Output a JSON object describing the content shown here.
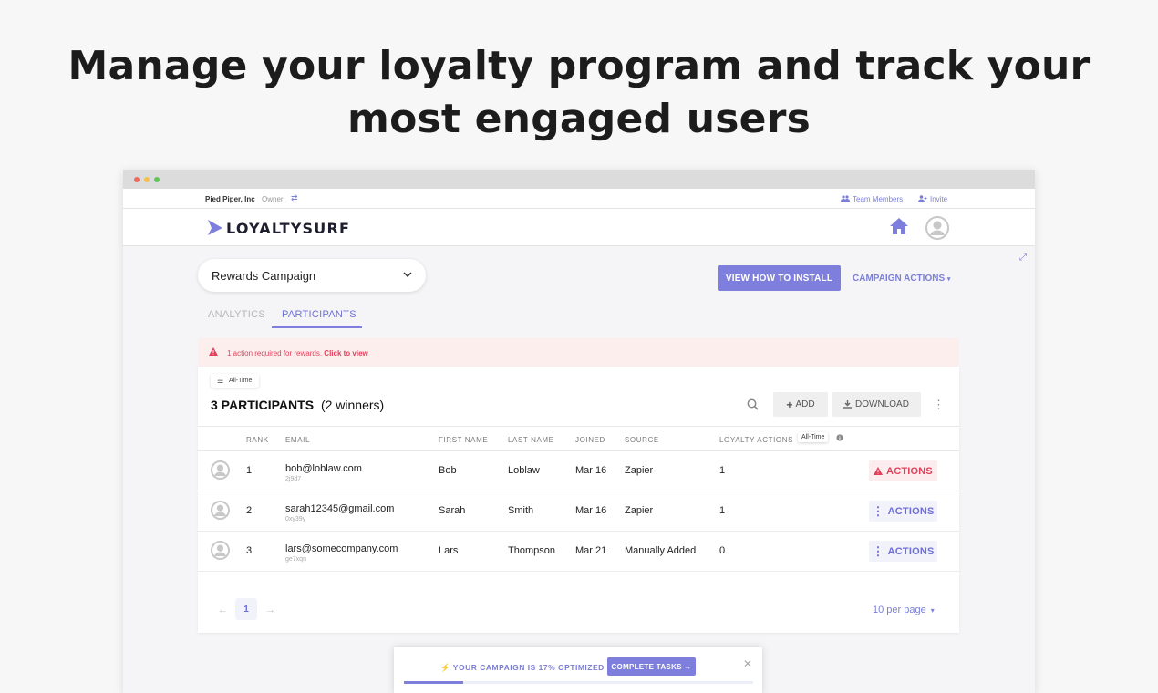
{
  "hero": {
    "line1": "Manage your loyalty program and track your",
    "line2": "most engaged users"
  },
  "colors": {
    "accent": "#7e7fdc",
    "warning": "#e0405a",
    "window_dots": [
      "#ed6a5e",
      "#f5bf4f",
      "#61c554"
    ]
  },
  "orgbar": {
    "org_name": "Pied Piper, Inc",
    "role": "Owner",
    "team_members": "Team Members",
    "invite": "Invite"
  },
  "navbar": {
    "logo_text": "LOYALTYSURF",
    "icons": [
      "home-icon",
      "user-avatar"
    ]
  },
  "campaign": {
    "selected": "Rewards Campaign",
    "install_button": "VIEW HOW TO INSTALL",
    "actions_menu": "CAMPAIGN ACTIONS"
  },
  "tabs": [
    {
      "label": "ANALYTICS",
      "active": false
    },
    {
      "label": "PARTICIPANTS",
      "active": true
    }
  ],
  "alert": {
    "message": "1 action required for rewards.",
    "link": "Click to view"
  },
  "panel": {
    "filter_chip": "All-Time",
    "title_count": "3 PARTICIPANTS",
    "title_winners": "(2 winners)",
    "add_button": "ADD",
    "download_button": "DOWNLOAD"
  },
  "table": {
    "headers": [
      "RANK",
      "EMAIL",
      "FIRST NAME",
      "LAST NAME",
      "JOINED",
      "SOURCE",
      "LOYALTY ACTIONS"
    ],
    "loyalty_tooltip": "All-Time",
    "rows": [
      {
        "rank": "1",
        "email": "bob@loblaw.com",
        "code": "2j9d7",
        "first": "Bob",
        "last": "Loblaw",
        "joined": "Mar 16",
        "source": "Zapier",
        "actions": "1",
        "action_label": "ACTIONS",
        "warning": true
      },
      {
        "rank": "2",
        "email": "sarah12345@gmail.com",
        "code": "0xy39y",
        "first": "Sarah",
        "last": "Smith",
        "joined": "Mar 16",
        "source": "Zapier",
        "actions": "1",
        "action_label": "ACTIONS",
        "warning": false
      },
      {
        "rank": "3",
        "email": "lars@somecompany.com",
        "code": "ge7xqn",
        "first": "Lars",
        "last": "Thompson",
        "joined": "Mar 21",
        "source": "Manually Added",
        "actions": "0",
        "action_label": "ACTIONS",
        "warning": false
      }
    ]
  },
  "pagination": {
    "current_page": "1",
    "per_page": "10 per page"
  },
  "optimization": {
    "text": "⚡ YOUR CAMPAIGN IS 17% OPTIMIZED",
    "button": "COMPLETE TASKS →",
    "progress_percent": 17
  }
}
